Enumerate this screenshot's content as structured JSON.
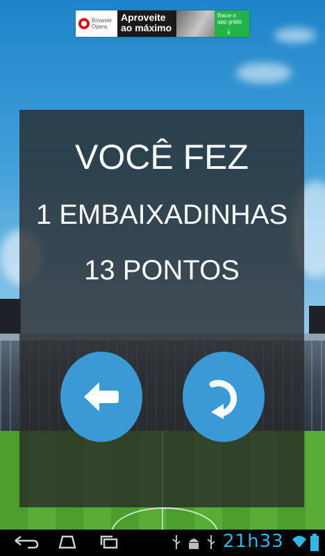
{
  "ad": {
    "brand_line1": "Browser",
    "brand_line2": "Opera",
    "headline_line1": "Aproveite",
    "headline_line2": "ao máximo",
    "cta_line1": "Baixe o",
    "cta_line2": "app grátis",
    "colors": {
      "opera_red": "#d4141a",
      "cta_green": "#22b34a"
    }
  },
  "result": {
    "title": "VOCÊ FEZ",
    "kicks_text": "1 EMBAIXADINHAS",
    "points_text": "13 PONTOS"
  },
  "buttons": {
    "back_icon": "arrow-left-icon",
    "replay_icon": "replay-icon",
    "color": "#3b9ad6"
  },
  "navbar": {
    "clock": "21h33",
    "clock_color": "#33b5e5",
    "icons": [
      "back-icon",
      "home-icon",
      "recent-apps-icon",
      "usb-icon",
      "android-debug-icon",
      "usb-icon",
      "wifi-icon",
      "battery-icon"
    ]
  }
}
